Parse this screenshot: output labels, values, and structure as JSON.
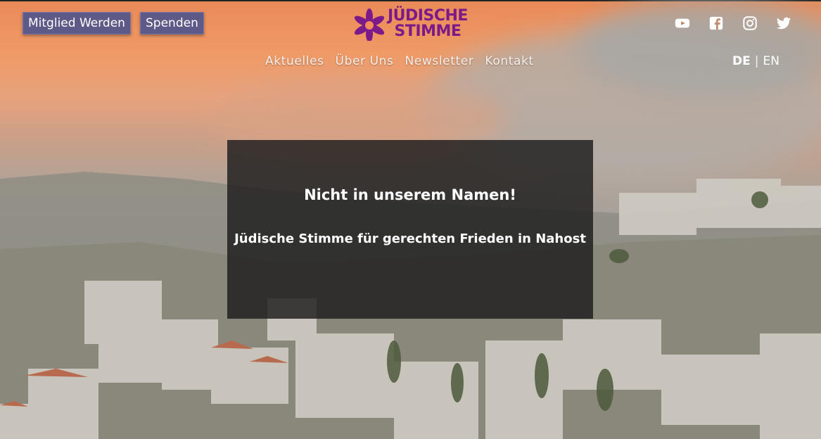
{
  "header": {
    "member_button": "Mitglied Werden",
    "donate_button": "Spenden",
    "logo": {
      "line1": "JÜDISCHE",
      "line2": "STIMME",
      "icon": "star-flower-icon",
      "color": "#7d1a8a"
    },
    "social_icons": [
      "youtube-icon",
      "facebook-icon",
      "instagram-icon",
      "twitter-icon"
    ],
    "lang": {
      "de": "DE",
      "separator": "|",
      "en": "EN",
      "active": "DE"
    }
  },
  "nav": {
    "items": [
      "Aktuelles",
      "Über Uns",
      "Newsletter",
      "Kontakt"
    ]
  },
  "hero": {
    "title": "Nicht in unserem Namen!",
    "subtitle": "Jüdische Stimme für gerechten Frieden in Nahost"
  },
  "colors": {
    "button_bg": "#5e5a88",
    "accent": "#7d1a8a",
    "overlay": "#1c1c1c"
  }
}
